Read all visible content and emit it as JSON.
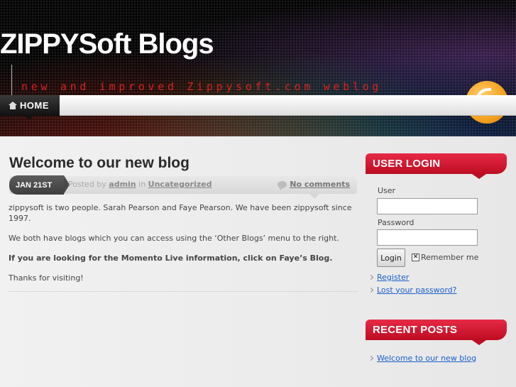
{
  "site": {
    "title": "ZIPPYSoft Blogs",
    "tagline": "new and improved Zippysoft.com weblog"
  },
  "nav": {
    "home_label": "HOME"
  },
  "post": {
    "title": "Welcome to our new blog",
    "date": "JAN 21ST",
    "posted_by_prefix": "Posted by",
    "author": "admin",
    "in_word": "in",
    "category": "Uncategorized",
    "comments_label": "No comments",
    "paragraphs": [
      "zippysoft is two people. Sarah Pearson and Faye Pearson. We have been zippysoft since 1997.",
      "We both have blogs which you can access using the ‘Other Blogs’ menu to the right.",
      "If you are looking for the Momento Live information, click on Faye’s Blog.",
      "Thanks for visiting!"
    ]
  },
  "sidebar": {
    "login": {
      "heading": "USER LOGIN",
      "user_label": "User",
      "password_label": "Password",
      "user_value": "",
      "password_value": "",
      "button_label": "Login",
      "remember_label": "Remember me",
      "remember_checked": true,
      "links": [
        "Register",
        "Lost your password?"
      ]
    },
    "recent": {
      "heading": "RECENT POSTS",
      "items": [
        "Welcome to our new blog"
      ]
    }
  },
  "colors": {
    "accent_red": "#d52220",
    "link_blue": "#1c5fc9",
    "widget_red": "#e62a46"
  }
}
